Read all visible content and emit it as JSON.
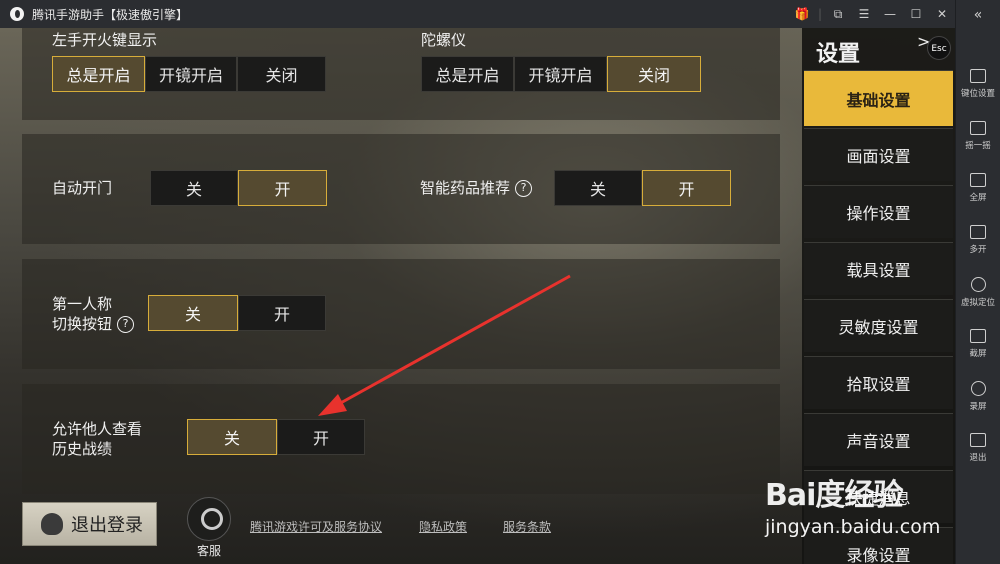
{
  "titlebar": {
    "title": "腾讯手游助手【极速傲引擎】"
  },
  "toolbar": {
    "items": [
      {
        "label": "键位设置",
        "icon": "keyboard-icon"
      },
      {
        "label": "摇一摇",
        "icon": "shake-icon"
      },
      {
        "label": "全屏",
        "icon": "fullscreen-icon"
      },
      {
        "label": "多开",
        "icon": "multi-instance-icon"
      },
      {
        "label": "虚拟定位",
        "icon": "location-icon"
      },
      {
        "label": "截屏",
        "icon": "screenshot-icon"
      },
      {
        "label": "录屏",
        "icon": "record-icon"
      },
      {
        "label": "退出",
        "icon": "exit-icon"
      }
    ]
  },
  "settings": {
    "left_fire": {
      "label": "左手开火键显示",
      "options": [
        "总是开启",
        "开镜开启",
        "关闭"
      ],
      "selected": 0
    },
    "gyroscope": {
      "label": "陀螺仪",
      "options": [
        "总是开启",
        "开镜开启",
        "关闭"
      ],
      "selected": 2
    },
    "auto_door": {
      "label": "自动开门",
      "options": [
        "关",
        "开"
      ],
      "selected": 1
    },
    "med_recommend": {
      "label": "智能药品推荐",
      "options": [
        "关",
        "开"
      ],
      "selected": 1
    },
    "first_person": {
      "label_line1": "第一人称",
      "label_line2": "切换按钮",
      "options": [
        "关",
        "开"
      ],
      "selected": 0
    },
    "history": {
      "label_line1": "允许他人查看",
      "label_line2": "历史战绩",
      "options": [
        "关",
        "开"
      ],
      "selected": 0
    }
  },
  "menu": {
    "title": "设置",
    "esc": "Esc",
    "items": [
      "基础设置",
      "画面设置",
      "操作设置",
      "载具设置",
      "灵敏度设置",
      "拾取设置",
      "声音设置",
      "快捷消息",
      "录像设置"
    ],
    "active": 0
  },
  "bottom": {
    "logout": "退出登录",
    "service": "客服",
    "links": [
      "腾讯游戏许可及服务协议",
      "隐私政策",
      "服务条款"
    ]
  },
  "watermark": {
    "brand": "Bai度经验",
    "url": "jingyan.baidu.com"
  },
  "colors": {
    "accent": "#e9b93a",
    "active_border": "#d7ad3a",
    "arrow": "#e8322d"
  }
}
